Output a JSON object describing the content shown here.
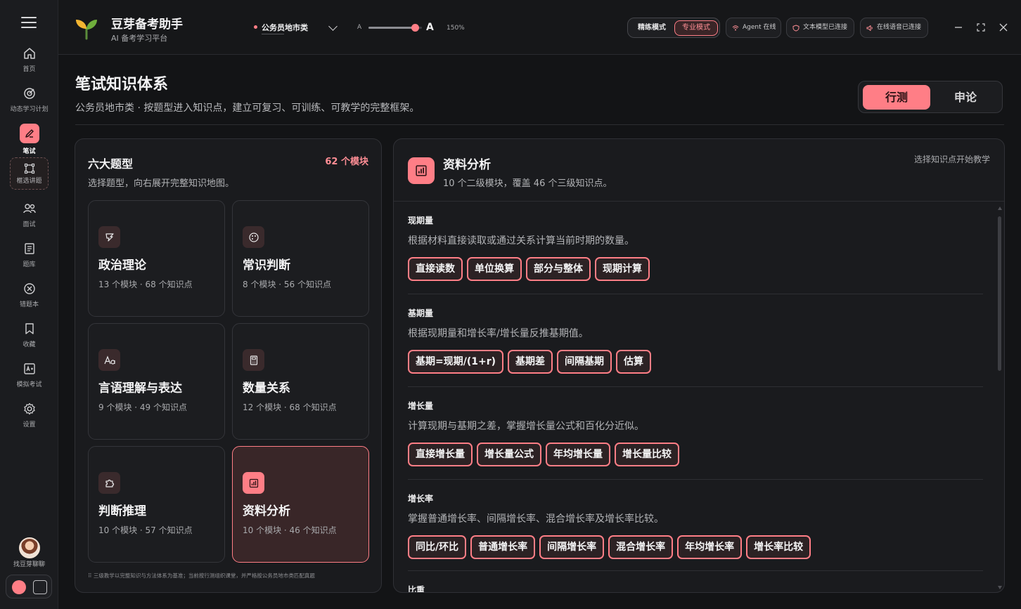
{
  "app": {
    "title": "豆芽备考助手",
    "subtitle": "AI 备考学习平台"
  },
  "topbar": {
    "track": "公务员地市类",
    "font_small": "A",
    "font_big": "A",
    "zoom": "150%",
    "zoom_fraction": 0.94,
    "mode_practice": "精练模式",
    "mode_pro": "专业模式",
    "status_agent": "Agent 在线",
    "status_text_model": "文本模型已连接",
    "status_voice": "在线语音已连接"
  },
  "sidebar": {
    "items": [
      {
        "label": "首页",
        "icon": "home-icon"
      },
      {
        "label": "动态学习计划",
        "icon": "target-icon"
      },
      {
        "label": "笔试",
        "icon": "pencil-icon",
        "active": true
      },
      {
        "label": "框选讲题",
        "icon": "select-frame-icon"
      },
      {
        "label": "面试",
        "icon": "people-icon"
      },
      {
        "label": "题库",
        "icon": "book-icon"
      },
      {
        "label": "错题本",
        "icon": "x-circle-icon"
      },
      {
        "label": "收藏",
        "icon": "bookmark-icon"
      },
      {
        "label": "模拟考试",
        "icon": "exam-icon"
      },
      {
        "label": "设置",
        "icon": "gear-icon"
      }
    ],
    "chat_label": "找豆芽聊聊"
  },
  "page": {
    "title": "笔试知识体系",
    "subtitle": "公务员地市类 · 按题型进入知识点，建立可复习、可训练、可教学的完整框架。",
    "seg_on": "行测",
    "seg_off": "申论"
  },
  "left": {
    "title": "六大题型",
    "count": "62 个模块",
    "subtitle": "选择题型，向右展开完整知识地图。",
    "cards": [
      {
        "name": "政治理论",
        "meta": "13 个模块 · 68 个知识点",
        "icon": "flag-icon"
      },
      {
        "name": "常识判断",
        "meta": "8 个模块 · 56 个知识点",
        "icon": "palette-icon"
      },
      {
        "name": "言语理解与表达",
        "meta": "9 个模块 · 49 个知识点",
        "icon": "text-aa-icon"
      },
      {
        "name": "数量关系",
        "meta": "12 个模块 · 68 个知识点",
        "icon": "calculator-icon"
      },
      {
        "name": "判断推理",
        "meta": "10 个模块 · 57 个知识点",
        "icon": "puzzle-icon"
      },
      {
        "name": "资料分析",
        "meta": "10 个模块 · 46 个知识点",
        "icon": "bar-chart-icon",
        "active": true
      }
    ],
    "footnote": "三级教学以完整知识与方法体系为基准；当前按行测组织课堂，并严格按公务员地市类匹配真题"
  },
  "right": {
    "title": "资料分析",
    "subtitle": "10 个二级模块，覆盖 46 个三级知识点。",
    "hint": "选择知识点开始教学",
    "sections": [
      {
        "name": "现期量",
        "desc": "根据材料直接读取或通过关系计算当前时期的数量。",
        "tags": [
          "直接读数",
          "单位换算",
          "部分与整体",
          "现期计算"
        ]
      },
      {
        "name": "基期量",
        "desc": "根据现期量和增长率/增长量反推基期值。",
        "tags": [
          "基期=现期/(1+r)",
          "基期差",
          "间隔基期",
          "估算"
        ]
      },
      {
        "name": "增长量",
        "desc": "计算现期与基期之差，掌握增长量公式和百化分近似。",
        "tags": [
          "直接增长量",
          "增长量公式",
          "年均增长量",
          "增长量比较"
        ]
      },
      {
        "name": "增长率",
        "desc": "掌握普通增长率、间隔增长率、混合增长率及增长率比较。",
        "tags": [
          "同比/环比",
          "普通增长率",
          "间隔增长率",
          "混合增长率",
          "年均增长率",
          "增长率比较"
        ]
      },
      {
        "name": "比重",
        "desc": "",
        "tags": []
      }
    ]
  }
}
